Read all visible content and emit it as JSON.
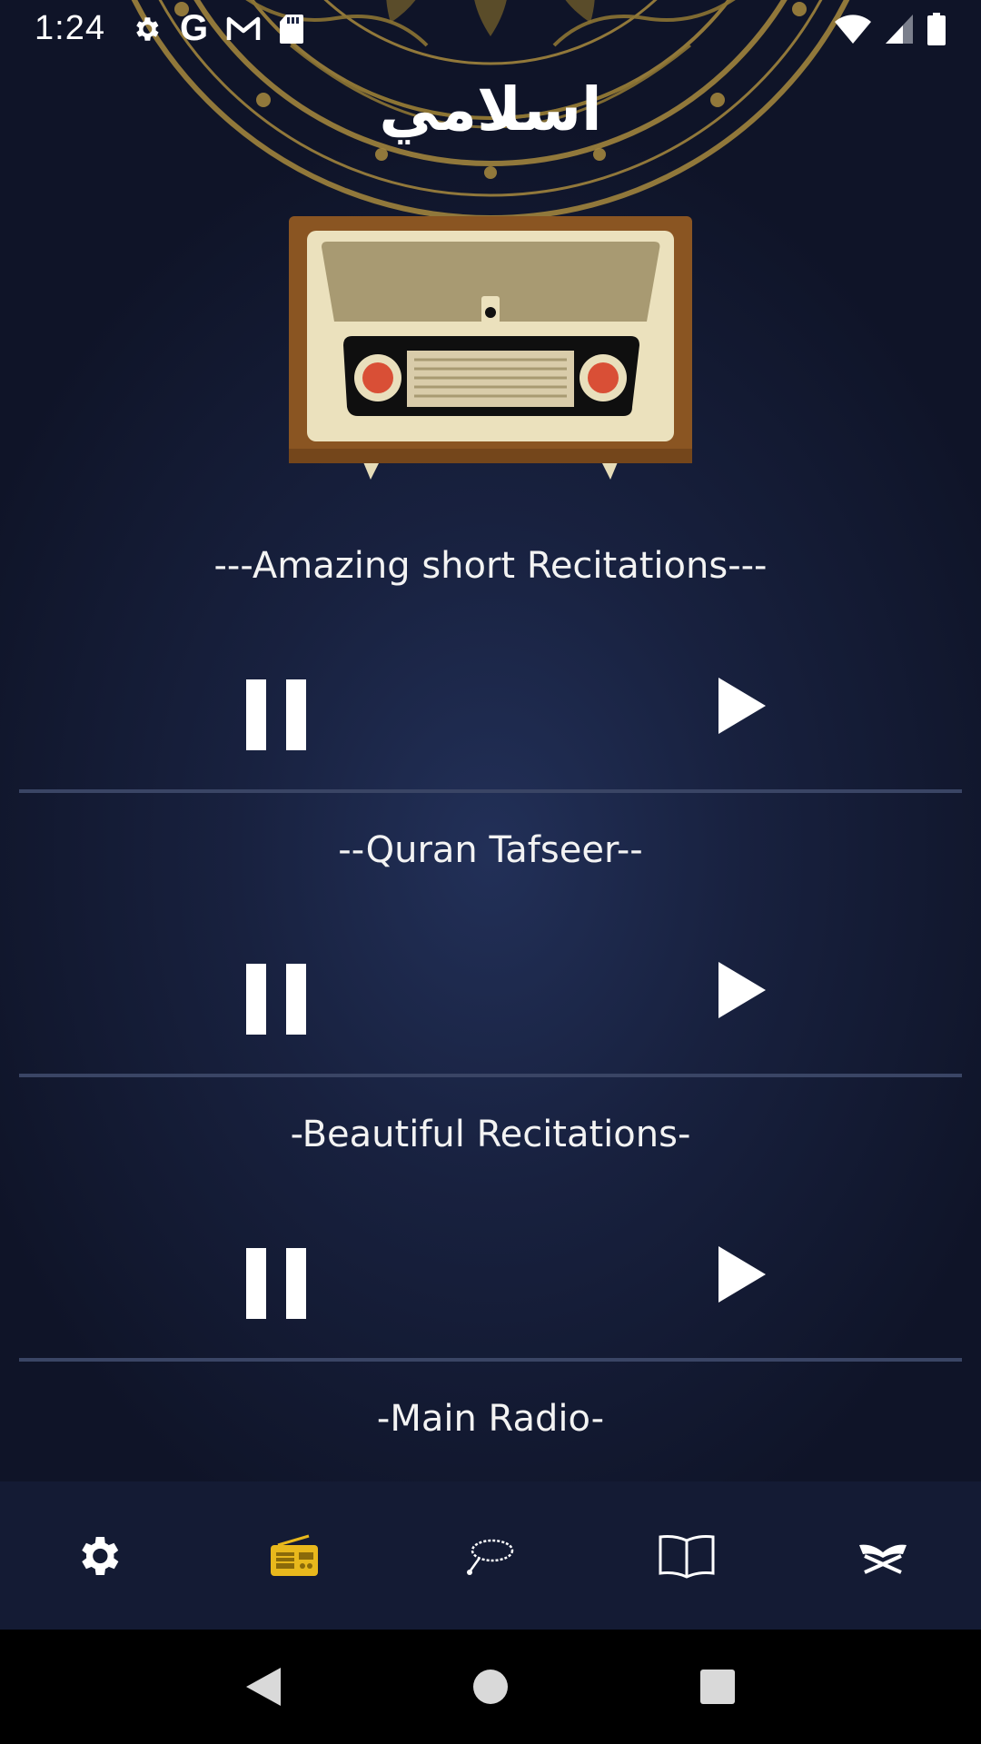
{
  "status_bar": {
    "time": "1:24",
    "left_icons": [
      "gear-icon",
      "google-icon",
      "gmail-icon",
      "sd-card-icon"
    ],
    "google_glyph": "G",
    "right_icons": [
      "wifi-icon",
      "cellular-signal-icon",
      "battery-icon"
    ]
  },
  "header": {
    "title": "اسلامي"
  },
  "stations": [
    {
      "title": "---Amazing short Recitations---"
    },
    {
      "title": "--Quran Tafseer--"
    },
    {
      "title": "-Beautiful Recitations-"
    },
    {
      "title": "-Main Radio-"
    }
  ],
  "bottom_nav": {
    "active_index": 1,
    "active_color": "#e8b81c",
    "items": [
      "settings-icon",
      "radio-icon",
      "tasbih-icon",
      "book-icon",
      "quran-icon"
    ]
  },
  "system_nav": [
    "back-icon",
    "home-icon",
    "recents-icon"
  ],
  "colors": {
    "background": "#18213f",
    "bottom_nav": "#141b34",
    "divider": "#3a4565",
    "ornament": "#a88a3e"
  }
}
